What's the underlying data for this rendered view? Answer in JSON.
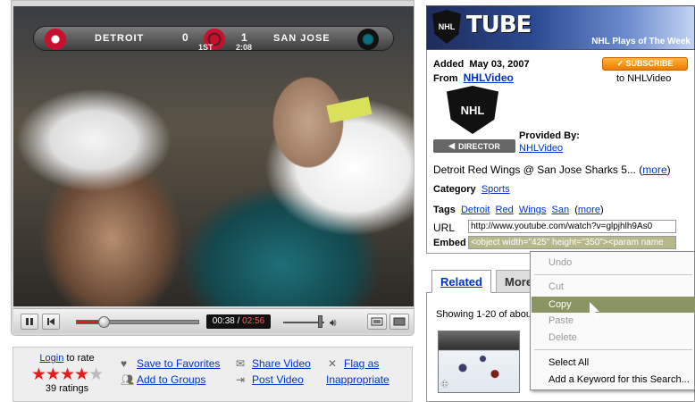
{
  "player": {
    "scoreboard": {
      "home_team": "DETROIT",
      "home_score": "0",
      "away_score": "1",
      "away_team": "SAN JOSE",
      "period": "1ST",
      "clock": "2:08"
    },
    "time_current": "00:38",
    "time_separator": "/",
    "time_total": "02:56",
    "progress_fraction": 0.22
  },
  "actions": {
    "login_label": "Login",
    "to_rate": " to rate",
    "ratings": "39 ratings",
    "stars_filled": 4,
    "stars_total": 5,
    "save_favorites": "Save to Favorites",
    "add_groups": "Add to Groups",
    "share_video": "Share Video",
    "post_video": "Post Video",
    "flag_line1": "Flag as",
    "flag_line2": "Inappropriate"
  },
  "channel": {
    "brand": "TUBE",
    "shield_text": "NHL",
    "tagline": "NHL Plays of The Week",
    "added_label": "Added",
    "added_date": "May 03, 2007",
    "from_label": "From",
    "from_user": "NHLVideo",
    "subscribe": "✓ SUBSCRIBE",
    "subscribe_to": "to NHLVideo",
    "director": "DIRECTOR",
    "provided_by": "Provided By:",
    "provided_user": "NHLVideo",
    "description": "Detroit Red Wings @ San Jose Sharks 5...",
    "more": "more",
    "category_label": "Category",
    "category": "Sports",
    "tags_label": "Tags",
    "tags": [
      "Detroit",
      "Red",
      "Wings",
      "San"
    ],
    "url_label": "URL",
    "url_value": "http://www.youtube.com/watch?v=glpjhlh9As0",
    "embed_label": "Embed",
    "embed_value": "<object width=\"425\" height=\"350\"><param name"
  },
  "related": {
    "tab_related": "Related",
    "tab_more": "More",
    "showing": "Showing 1-20 of abou"
  },
  "context_menu": {
    "undo": "Undo",
    "cut": "Cut",
    "copy": "Copy",
    "paste": "Paste",
    "delete": "Delete",
    "select_all": "Select All",
    "add_keyword": "Add a Keyword for this Search..."
  }
}
